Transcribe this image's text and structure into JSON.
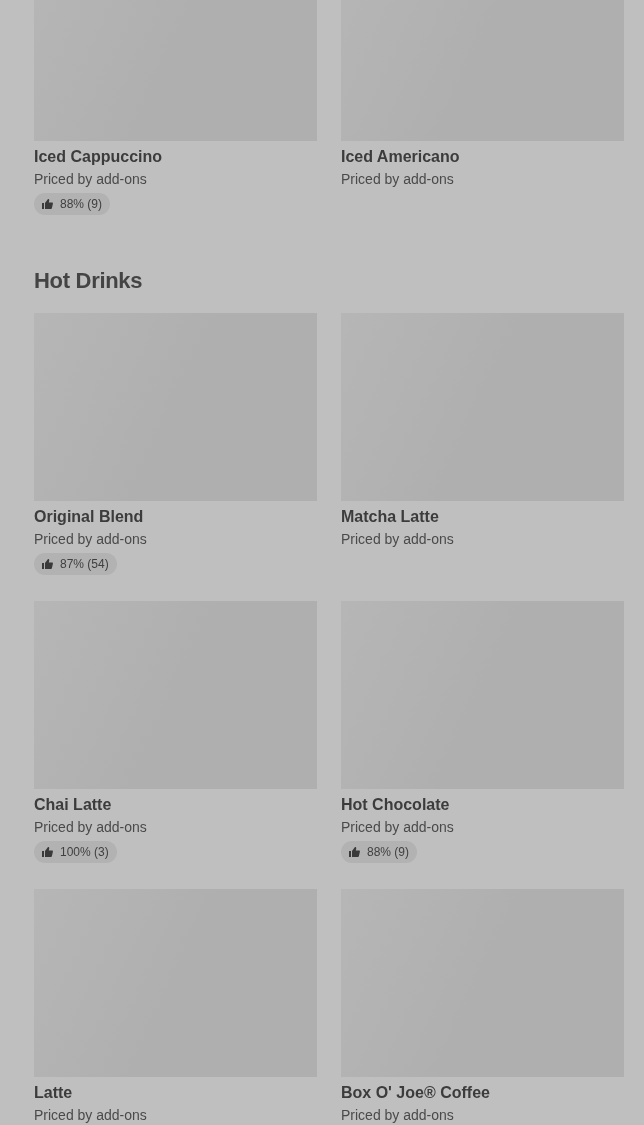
{
  "sections": [
    {
      "items": [
        {
          "name": "Iced Cappuccino",
          "price": "Priced by add-ons",
          "rating": "88% (9)"
        },
        {
          "name": "Iced Americano",
          "price": "Priced by add-ons"
        }
      ]
    },
    {
      "title": "Hot Drinks",
      "items": [
        {
          "name": "Original Blend",
          "price": "Priced by add-ons",
          "rating": "87% (54)"
        },
        {
          "name": "Matcha Latte",
          "price": "Priced by add-ons"
        },
        {
          "name": "Chai Latte",
          "price": "Priced by add-ons",
          "rating": "100% (3)"
        },
        {
          "name": "Hot Chocolate",
          "price": "Priced by add-ons",
          "rating": "88% (9)"
        },
        {
          "name": "Latte",
          "price": "Priced by add-ons"
        },
        {
          "name": "Box O' Joe® Coffee",
          "price": "Priced by add-ons"
        }
      ]
    }
  ]
}
